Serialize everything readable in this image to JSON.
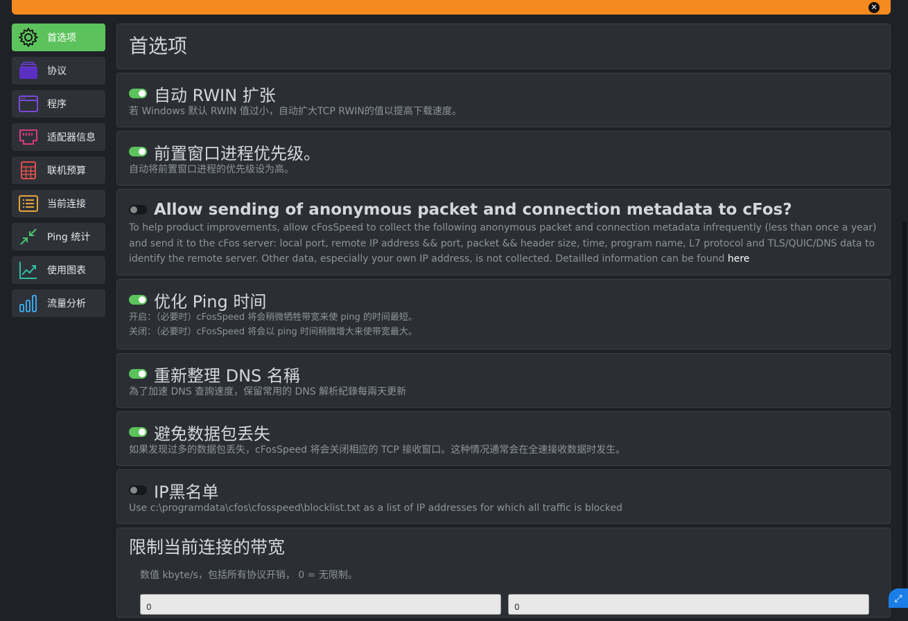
{
  "topbar": {
    "close_symbol": "✕"
  },
  "sidebar": {
    "items": [
      {
        "label": "首选项",
        "icon": "gear-icon",
        "active": true
      },
      {
        "label": "协议",
        "icon": "stack-icon"
      },
      {
        "label": "程序",
        "icon": "window-icon"
      },
      {
        "label": "适配器信息",
        "icon": "network-port-icon"
      },
      {
        "label": "联机预算",
        "icon": "calculator-icon"
      },
      {
        "label": "当前连接",
        "icon": "list-icon"
      },
      {
        "label": "Ping 统计",
        "icon": "arrows-in-icon"
      },
      {
        "label": "使用图表",
        "icon": "line-chart-icon"
      },
      {
        "label": "流量分析",
        "icon": "bar-chart-icon"
      }
    ]
  },
  "main": {
    "title": "首选项",
    "options": [
      {
        "title": "自动 RWIN 扩张",
        "on": true,
        "desc": [
          "若 Windows 默认 RWIN 值过小，自动扩大TCP RWIN的值以提高下载速度。"
        ]
      },
      {
        "title": "前置窗口进程优先级。",
        "on": true,
        "desc": [
          "自动将前置窗口进程的优先级设为高。"
        ]
      },
      {
        "title": "Allow sending of anonymous packet and connection metadata to cFos?",
        "on": false,
        "desc": [
          "To help product improvements, allow cFosSpeed to collect the following anonymous packet and connection metadata infrequently (less than once a year) and send it to the cFos server: local port, remote IP address && port, packet && header size, time, program name, L7 protocol and TLS/QUIC/DNS data to identify the remote server. Other data, especially your own IP address, is not collected. Detailled information can be found"
        ],
        "link": "here"
      },
      {
        "title": "优化 Ping 时间",
        "on": true,
        "desc": [
          "开启：（必要时）cFosSpeed 将会稍微牺牲带宽来使 ping 的时间最短。",
          "关闭：（必要时）cFosSpeed 将会以 ping 时间稍微增大来使带宽最大。"
        ]
      },
      {
        "title": "重新整理 DNS 名稱",
        "on": true,
        "desc": [
          "為了加速 DNS 查詢速度，保留常用的 DNS 解析紀錄每兩天更新"
        ]
      },
      {
        "title": "避免数据包丢失",
        "on": true,
        "desc": [
          "如果发现过多的数据包丢失，cFosSpeed 将会关闭相应的 TCP 接收窗口。这种情况通常会在全速接收数据时发生。"
        ]
      },
      {
        "title": "IP黑名单",
        "on": false,
        "desc": [
          "Use c:\\programdata\\cfos\\cfosspeed\\blocklist.txt as a list of IP addresses for which all traffic is blocked"
        ]
      }
    ],
    "limit": {
      "title": "限制当前连接的带宽",
      "desc": "数值 kbyte/s，包括所有协议开销， 0 = 无限制。",
      "input1_value": "0",
      "input2_value": "0"
    }
  },
  "resize_symbol": "⤢"
}
